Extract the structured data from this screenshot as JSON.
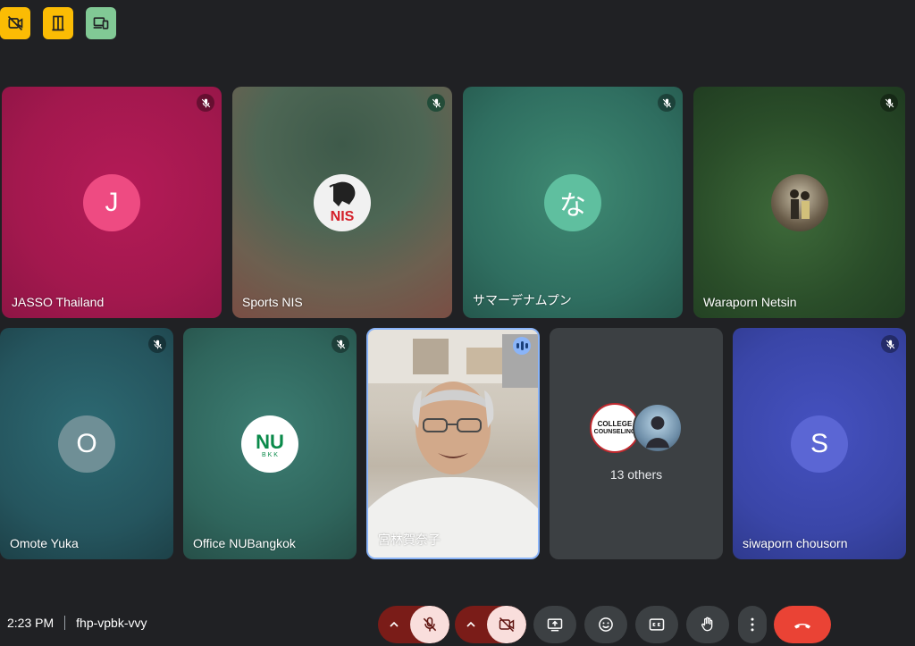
{
  "top_chips": [
    {
      "icon": "recording-off-icon",
      "color": "#fbbc04"
    },
    {
      "icon": "door-icon",
      "color": "#fbbc04"
    },
    {
      "icon": "devices-icon",
      "color": "#81c995"
    }
  ],
  "tiles": [
    {
      "name": "JASSO Thailand",
      "avatar_letter": "J",
      "avatar_color": "#ee4b82",
      "muted": true
    },
    {
      "name": "Sports NIS",
      "avatar_logo": "NIS",
      "muted": true
    },
    {
      "name": "サマーデナムプン",
      "avatar_letter": "な",
      "avatar_color": "#5fbf9f",
      "muted": true
    },
    {
      "name": "Waraporn Netsin",
      "avatar_photo": true,
      "muted": true
    },
    {
      "name": "Omote Yuka",
      "avatar_letter": "O",
      "avatar_color": "#6f8f96",
      "muted": true
    },
    {
      "name": "Office NUBangkok",
      "avatar_logo": "NU",
      "avatar_logo_sub": "B K K",
      "muted": true
    },
    {
      "name": "宮林賀奈子",
      "video": true,
      "speaking": true
    },
    {
      "others_label": "13 others",
      "others_avatar_text": [
        "COLLEGE",
        "COUNSELING"
      ]
    },
    {
      "name": "siwaporn chousorn",
      "avatar_letter": "S",
      "avatar_color": "#5b66d4",
      "muted": true
    }
  ],
  "bottom": {
    "time": "2:23 PM",
    "meeting_code": "fhp-vpbk-vvy"
  },
  "colors": {
    "background": "#202124",
    "danger": "#ea4335",
    "speaking_ring": "#8ab4f8"
  }
}
